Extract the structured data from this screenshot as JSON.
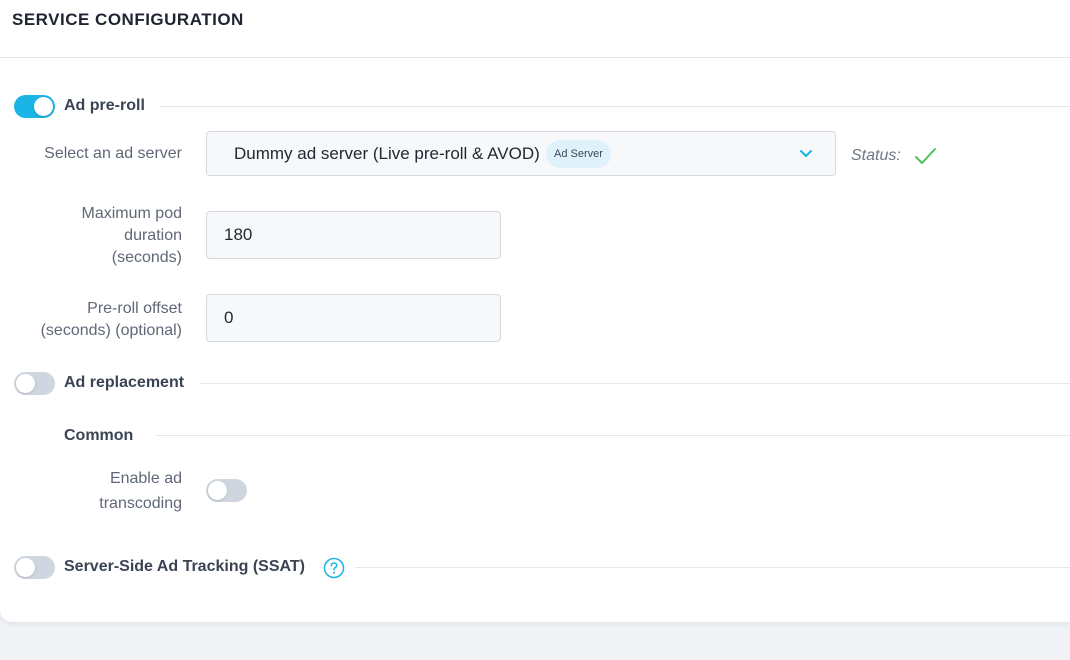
{
  "header": {
    "title": "SERVICE CONFIGURATION"
  },
  "ad_preroll": {
    "label": "Ad pre-roll",
    "enabled": true,
    "ad_server_label": "Select an ad server",
    "ad_server_value": "Dummy ad server (Live pre-roll & AVOD)",
    "ad_server_badge": "Ad Server",
    "status_label": "Status:",
    "max_pod_label_line1": "Maximum pod",
    "max_pod_label_line2": "duration",
    "max_pod_label_line3": "(seconds)",
    "max_pod_value": "180",
    "offset_label_line1": "Pre-roll offset",
    "offset_label_line2": "(seconds) (optional)",
    "offset_value": "0"
  },
  "ad_replacement": {
    "label": "Ad replacement",
    "enabled": false,
    "common_label": "Common",
    "transcoding_label_line1": "Enable ad",
    "transcoding_label_line2": "transcoding",
    "transcoding_enabled": false
  },
  "ssat": {
    "label": "Server-Side Ad Tracking (SSAT)",
    "enabled": false,
    "help_icon": "question-circle-icon"
  },
  "colors": {
    "accent": "#1ab4e6",
    "status_ok": "#4cc25a",
    "toggle_off": "#cfd6df",
    "badge_bg": "#dff1fa"
  }
}
